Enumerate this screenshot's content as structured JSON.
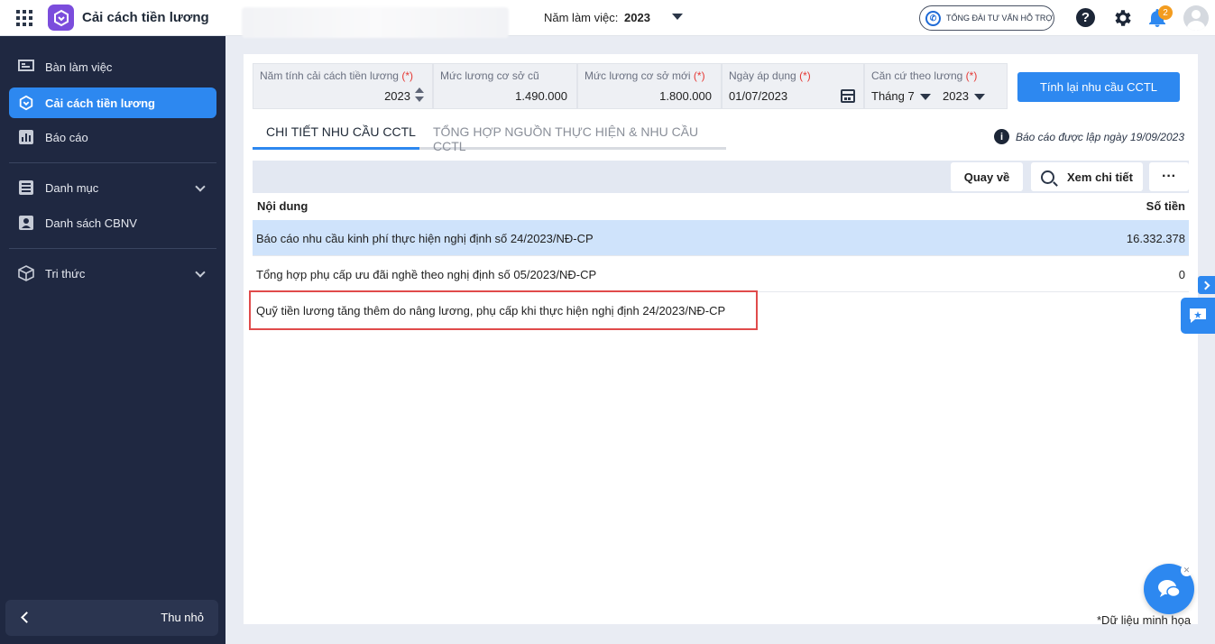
{
  "header": {
    "app_title": "Cải cách tiền lương",
    "year_label": "Năm làm việc:",
    "year_value": "2023",
    "hotline_label": "TỔNG ĐÀI TƯ VẤN HỖ TRỢ",
    "notification_count": "2"
  },
  "sidebar": {
    "items": [
      {
        "label": "Bàn làm việc",
        "icon": "desk-icon"
      },
      {
        "label": "Cải cách tiền lương",
        "icon": "app-logo-icon",
        "active": true
      },
      {
        "label": "Báo cáo",
        "icon": "chart-icon"
      },
      {
        "label": "Danh mục",
        "icon": "list-icon"
      },
      {
        "label": "Danh sách CBNV",
        "icon": "person-icon"
      },
      {
        "label": "Tri thức",
        "icon": "cube-icon"
      }
    ],
    "collapse_label": "Thu nhỏ"
  },
  "filters": {
    "year": {
      "label": "Năm tính cải cách tiền lương",
      "required": "(*)",
      "value": "2023"
    },
    "old_base": {
      "label": "Mức lương cơ sở cũ",
      "value": "1.490.000"
    },
    "new_base": {
      "label": "Mức lương cơ sở mới",
      "required": "(*)",
      "value": "1.800.000"
    },
    "apply_date": {
      "label": "Ngày áp dụng",
      "required": "(*)",
      "value": "01/07/2023"
    },
    "basis": {
      "label": "Căn cứ theo lương",
      "required": "(*)",
      "month": "Tháng 7",
      "year": "2023"
    },
    "recalc_button": "Tính lại nhu cầu CCTL"
  },
  "tabs": [
    {
      "label": "CHI TIẾT NHU CẦU CCTL",
      "active": true
    },
    {
      "label": "TỔNG HỢP NGUỒN THỰC HIỆN & NHU CẦU CCTL"
    }
  ],
  "report_date": "Báo cáo được lập ngày 19/09/2023",
  "toolbar": {
    "back_label": "Quay về",
    "detail_label": "Xem chi tiết",
    "more_label": "···"
  },
  "table": {
    "columns": [
      "Nội dung",
      "Số tiền"
    ],
    "rows": [
      {
        "content": "Báo cáo nhu cầu kinh phí thực hiện nghị định số 24/2023/NĐ-CP",
        "amount": "16.332.378"
      },
      {
        "content": "Tổng hợp phụ cấp ưu đãi nghề theo nghị định số 05/2023/NĐ-CP",
        "amount": "0"
      },
      {
        "content": "Quỹ tiền lương tăng thêm do nâng lương, phụ cấp khi thực hiện nghị định 24/2023/NĐ-CP",
        "amount": ""
      }
    ]
  },
  "footnote": "*Dữ liệu minh họa",
  "colors": {
    "primary": "#2d88f0",
    "sidebar": "#1f2841",
    "highlight": "#e04b4b",
    "selected_row": "#cfe3fb"
  }
}
